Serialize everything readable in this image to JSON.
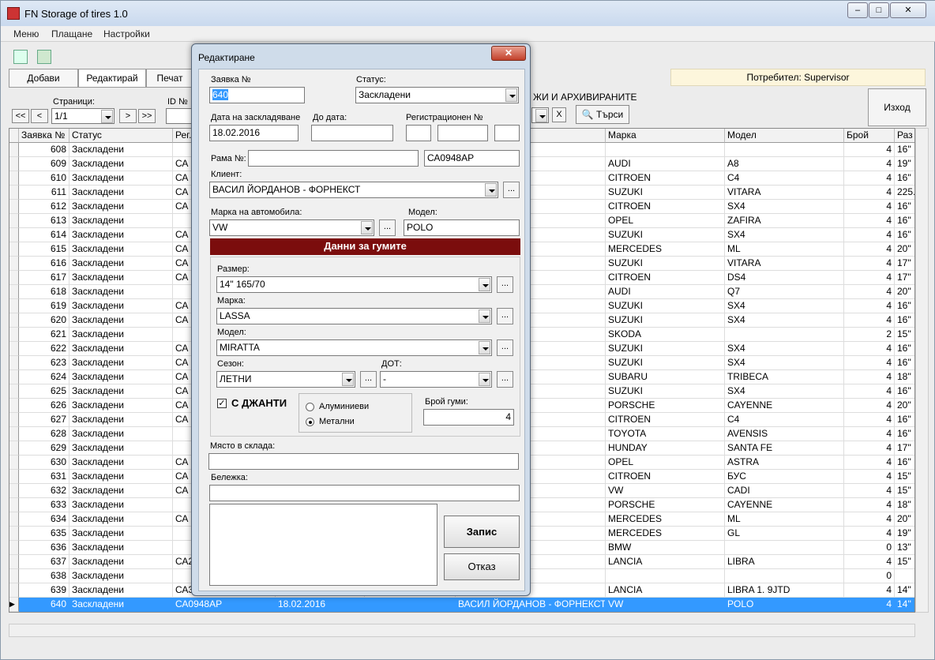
{
  "window": {
    "title": "FN Storage of tires 1.0",
    "controls": [
      "–",
      "□",
      "✕"
    ]
  },
  "menu": [
    "Меню",
    "Плащане",
    "Настройки"
  ],
  "toolbar": {
    "add": "Добави",
    "edit": "Редактирай",
    "print": "Печат"
  },
  "user_label": "Потребител: Supervisor",
  "exit_label": "Изход",
  "pager": {
    "label": "Страници:",
    "value": "1/1",
    "first": "<<",
    "prev": "<",
    "next": ">",
    "last": ">>"
  },
  "id_label": "ID №",
  "filter_text": "ЖИ И АРХИВИРАНИТЕ",
  "clear_btn": "X",
  "search_btn": "Търси",
  "columns": [
    "Заявка №",
    "Статус",
    "Рег.",
    "Марка",
    "Модел",
    "Брой",
    "Раз"
  ],
  "rows": [
    {
      "id": "608",
      "status": "Заскладени",
      "reg": "",
      "extra": "ЪРВЕНИЦА/",
      "make": "",
      "model": "",
      "qty": "4",
      "size": "16''"
    },
    {
      "id": "609",
      "status": "Заскладени",
      "reg": "СА 7",
      "extra": "",
      "make": "AUDI",
      "model": "A8",
      "qty": "4",
      "size": "19''"
    },
    {
      "id": "610",
      "status": "Заскладени",
      "reg": "СА 4",
      "extra": "",
      "make": "CITROEN",
      "model": "C4",
      "qty": "4",
      "size": "16''"
    },
    {
      "id": "611",
      "status": "Заскладени",
      "reg": "СА 7",
      "extra": "",
      "make": "SUZUKI",
      "model": "VITARA",
      "qty": "4",
      "size": "225."
    },
    {
      "id": "612",
      "status": "Заскладени",
      "reg": "СА 3",
      "extra": "",
      "make": "CITROEN",
      "model": "SX4",
      "qty": "4",
      "size": "16''"
    },
    {
      "id": "613",
      "status": "Заскладени",
      "reg": "",
      "extra": "НОВ",
      "make": "OPEL",
      "model": "ZAFIRA",
      "qty": "4",
      "size": "16''"
    },
    {
      "id": "614",
      "status": "Заскладени",
      "reg": "СА 6",
      "extra": "",
      "make": "SUZUKI",
      "model": "SX4",
      "qty": "4",
      "size": "16''"
    },
    {
      "id": "615",
      "status": "Заскладени",
      "reg": "СА 7",
      "extra": "",
      "make": "MERCEDES",
      "model": "ML",
      "qty": "4",
      "size": "20''"
    },
    {
      "id": "616",
      "status": "Заскладени",
      "reg": "СА 2",
      "extra": "",
      "make": "SUZUKI",
      "model": "VITARA",
      "qty": "4",
      "size": "17''"
    },
    {
      "id": "617",
      "status": "Заскладени",
      "reg": "СА 4",
      "extra": "",
      "make": "CITROEN",
      "model": "DS4",
      "qty": "4",
      "size": "17''"
    },
    {
      "id": "618",
      "status": "Заскладени",
      "reg": "",
      "extra": "",
      "make": "AUDI",
      "model": "Q7",
      "qty": "4",
      "size": "20''"
    },
    {
      "id": "619",
      "status": "Заскладени",
      "reg": "СА 2",
      "extra": "",
      "make": "SUZUKI",
      "model": "SX4",
      "qty": "4",
      "size": "16''"
    },
    {
      "id": "620",
      "status": "Заскладени",
      "reg": "СА 7",
      "extra": "",
      "make": "SUZUKI",
      "model": "SX4",
      "qty": "4",
      "size": "16''"
    },
    {
      "id": "621",
      "status": "Заскладени",
      "reg": "",
      "extra": "",
      "make": "SKODA",
      "model": "",
      "qty": "2",
      "size": "15''"
    },
    {
      "id": "622",
      "status": "Заскладени",
      "reg": "СА 6",
      "extra": "",
      "make": "SUZUKI",
      "model": "SX4",
      "qty": "4",
      "size": "16''"
    },
    {
      "id": "623",
      "status": "Заскладени",
      "reg": "СА 5",
      "extra": "",
      "make": "SUZUKI",
      "model": "SX4",
      "qty": "4",
      "size": "16''"
    },
    {
      "id": "624",
      "status": "Заскладени",
      "reg": "СА 7",
      "extra": "",
      "make": "SUBARU",
      "model": "TRIBECA",
      "qty": "4",
      "size": "18''"
    },
    {
      "id": "625",
      "status": "Заскладени",
      "reg": "СА 5",
      "extra": "",
      "make": "SUZUKI",
      "model": "SX4",
      "qty": "4",
      "size": "16''"
    },
    {
      "id": "626",
      "status": "Заскладени",
      "reg": "СА 7",
      "extra": "",
      "make": "PORSCHE",
      "model": "CAYENNE",
      "qty": "4",
      "size": "20''"
    },
    {
      "id": "627",
      "status": "Заскладени",
      "reg": "СА 5",
      "extra": "",
      "make": "CITROEN",
      "model": "C4",
      "qty": "4",
      "size": "16''"
    },
    {
      "id": "628",
      "status": "Заскладени",
      "reg": "",
      "extra": "",
      "make": "TOYOTA",
      "model": "AVENSIS",
      "qty": "4",
      "size": "16''"
    },
    {
      "id": "629",
      "status": "Заскладени",
      "reg": "",
      "extra": "",
      "make": "HUNDAY",
      "model": "SANTA FE",
      "qty": "4",
      "size": "17''"
    },
    {
      "id": "630",
      "status": "Заскладени",
      "reg": "СА 6",
      "extra": "",
      "make": "OPEL",
      "model": "ASTRA",
      "qty": "4",
      "size": "16''"
    },
    {
      "id": "631",
      "status": "Заскладени",
      "reg": "СА 9",
      "extra": "",
      "make": "CITROEN",
      "model": "БУС",
      "qty": "4",
      "size": "15''"
    },
    {
      "id": "632",
      "status": "Заскладени",
      "reg": "СА 6",
      "extra": "",
      "make": "VW",
      "model": "CADI",
      "qty": "4",
      "size": "15''"
    },
    {
      "id": "633",
      "status": "Заскладени",
      "reg": "",
      "extra": "",
      "make": "PORSCHE",
      "model": "CAYENNE",
      "qty": "4",
      "size": "18''"
    },
    {
      "id": "634",
      "status": "Заскладени",
      "reg": "СА 3",
      "extra": "",
      "make": "MERCEDES",
      "model": "ML",
      "qty": "4",
      "size": "20''"
    },
    {
      "id": "635",
      "status": "Заскладени",
      "reg": "",
      "extra": "",
      "make": "MERCEDES",
      "model": "GL",
      "qty": "4",
      "size": "19''"
    },
    {
      "id": "636",
      "status": "Заскладени",
      "reg": "",
      "extra": "",
      "make": "BMW",
      "model": "",
      "qty": "0",
      "size": "13''"
    },
    {
      "id": "637",
      "status": "Заскладени",
      "reg": "СА2",
      "extra": "В - ФОРНЕКСТ",
      "make": "LANCIA",
      "model": "LIBRA",
      "qty": "4",
      "size": "15''"
    },
    {
      "id": "638",
      "status": "Заскладени",
      "reg": "",
      "extra": "",
      "make": "",
      "model": "",
      "qty": "0",
      "size": ""
    },
    {
      "id": "639",
      "status": "Заскладени",
      "reg": "СА3",
      "extra": "",
      "make": "LANCIA",
      "model": "LIBRA 1. 9JTD",
      "qty": "4",
      "size": "14''"
    },
    {
      "id": "640",
      "status": "Заскладени",
      "reg": "СА0948АР",
      "date": "18.02.2016",
      "extra": "ВАСИЛ ЙОРДАНОВ - ФОРНЕКСТ",
      "make": "VW",
      "model": "POLO",
      "qty": "4",
      "size": "14''"
    }
  ],
  "dialog": {
    "title": "Редактиране",
    "close": "✕",
    "order_label": "Заявка №",
    "order_value": "640",
    "status_label": "Статус:",
    "status_value": "Заскладени",
    "date_label": "Дата на заскладяване",
    "date_value": "18.02.2016",
    "todate_label": "До дата:",
    "reg_label": "Регистрационен №",
    "frame_label": "Рама №:",
    "frame_reg": "СА0948АР",
    "client_label": "Клиент:",
    "client_value": "ВАСИЛ ЙОРДАНОВ - ФОРНЕКСТ",
    "carmake_label": "Марка на автомобила:",
    "carmake_value": "VW",
    "carmodel_label": "Модел:",
    "carmodel_value": "POLO",
    "tires_header": "Данни за гумите",
    "size_label": "Размер:",
    "size_value": "14\" 165/70",
    "tmake_label": "Марка:",
    "tmake_value": "LASSA",
    "tmodel_label": "Модел:",
    "tmodel_value": "MIRATTA",
    "season_label": "Сезон:",
    "season_value": "ЛЕТНИ",
    "dot_label": "ДОТ:",
    "dot_value": "-",
    "rims_label": "С ДЖАНТИ",
    "rim_alu": "Алуминиеви",
    "rim_steel": "Метални",
    "count_label": "Брой гуми:",
    "count_value": "4",
    "place_label": "Място в склада:",
    "note_label": "Бележка:",
    "save": "Запис",
    "cancel": "Отказ",
    "dots": "..."
  }
}
